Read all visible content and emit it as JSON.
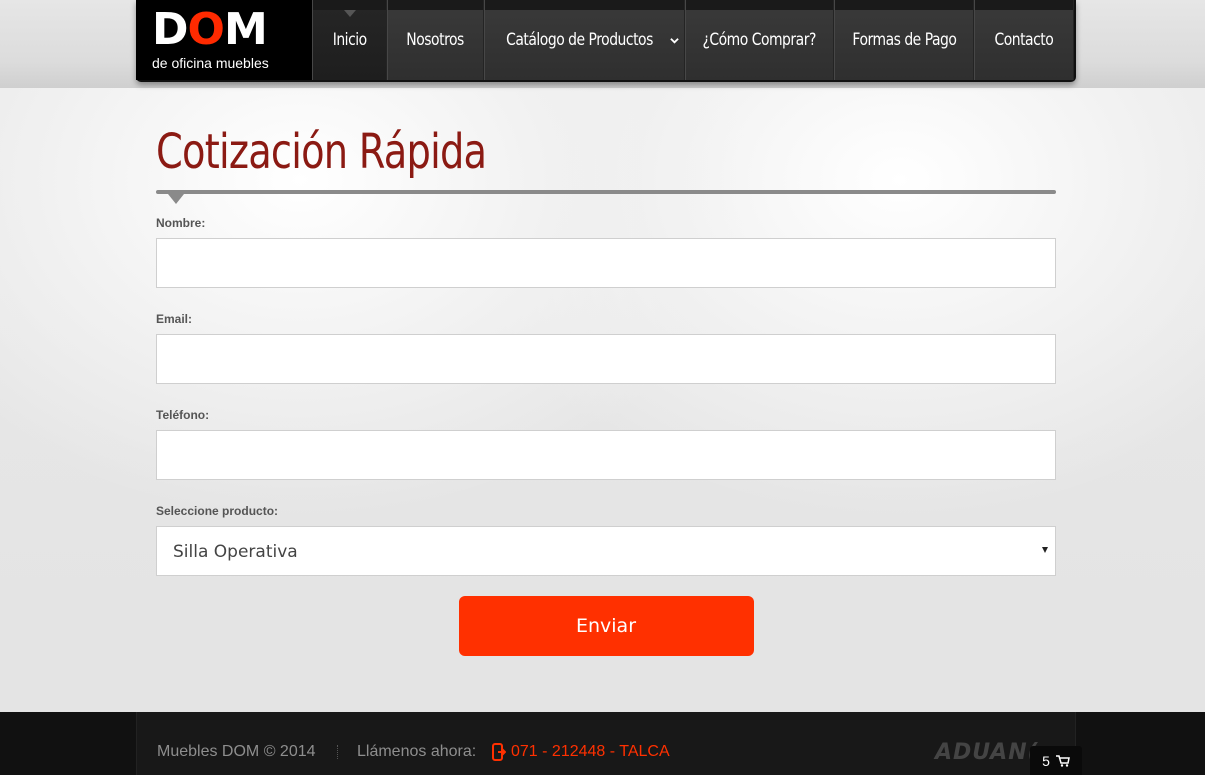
{
  "header": {
    "logo_word_start": "D",
    "logo_word_o": "O",
    "logo_word_end": "M",
    "logo_subtitle": "de oficina muebles",
    "menu": [
      {
        "label": "Inicio",
        "active": true
      },
      {
        "label": "Nosotros"
      },
      {
        "label": "Catálogo de Productos",
        "has_dropdown": true
      },
      {
        "label": "¿Cómo Comprar?"
      },
      {
        "label": "Formas de Pago"
      },
      {
        "label": "Contacto"
      }
    ]
  },
  "form": {
    "title": "Cotización Rápida",
    "name_label": "Nombre:",
    "name_value": "",
    "email_label": "Email:",
    "email_value": "",
    "phone_label": "Teléfono:",
    "phone_value": "",
    "product_label": "Seleccione producto:",
    "product_selected": "Silla Operativa",
    "submit_label": "Enviar"
  },
  "footer": {
    "copyright": "Muebles DOM © 2014",
    "call_label": "Llámenos ahora:",
    "phone": "071 - 212448 - TALCA",
    "brand": "ADUAN(",
    "cart_count": "5"
  },
  "colors": {
    "accent": "#ff3000",
    "title": "#8b1a13",
    "nav_background": "#111111"
  },
  "icons": {
    "dropdown": "chevron-down-icon",
    "phone": "phone-icon",
    "cart": "cart-icon"
  }
}
